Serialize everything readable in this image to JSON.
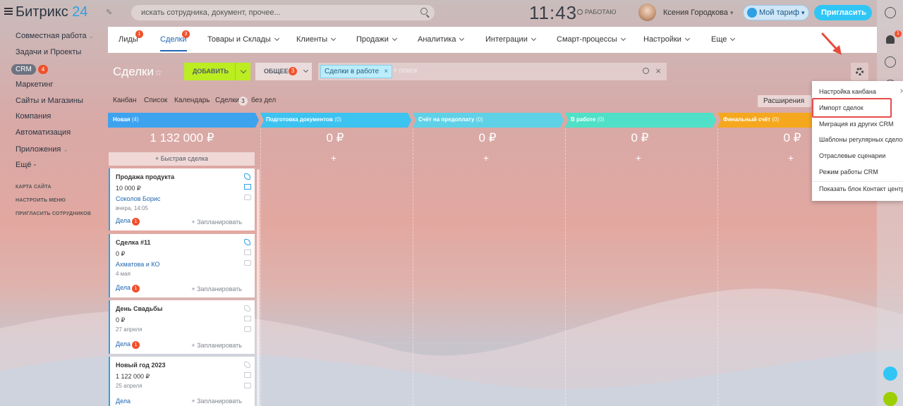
{
  "header": {
    "logo_text": "Битрикс",
    "logo_num": "24",
    "search_placeholder": "искать сотрудника, документ, прочее...",
    "clock": "11:43",
    "work_status": "РАБОТАЮ",
    "user_name": "Ксения Городкова",
    "tariff_label": "Мой тариф",
    "invite_label": "Пригласить"
  },
  "sidebar": {
    "items": [
      "Совместная работа",
      "Задачи и Проекты",
      "CRM",
      "Маркетинг",
      "Сайты и Магазины",
      "Компания",
      "Автоматизация",
      "Приложения",
      "Ещё -"
    ],
    "crm_badge": "4",
    "small_links": [
      "КАРТА САЙТА",
      "НАСТРОИТЬ МЕНЮ",
      "ПРИГЛАСИТЬ СОТРУДНИКОВ"
    ]
  },
  "tabs": {
    "items": [
      "Лиды",
      "Сделки",
      "Товары и Склады",
      "Клиенты",
      "Продажи",
      "Аналитика",
      "Интеграции",
      "Смарт-процессы",
      "Настройки",
      "Еще"
    ],
    "leads_badge": "1",
    "deals_badge": "3"
  },
  "toolbar": {
    "title": "Сделки",
    "add_label": "ДОБАВИТЬ",
    "filter_label": "ОБЩЕЕ",
    "filter_badge": "3",
    "chip_label": "Сделки в работе",
    "search_placeholder": "+ поиск"
  },
  "views": {
    "kanban": "Канбан",
    "list": "Список",
    "calendar": "Календарь",
    "deals_label": "Сделки:",
    "deals_count": "3",
    "no_tasks": "без дел",
    "extensions": "Расширения"
  },
  "columns": [
    {
      "name": "Новая",
      "count": "(4)",
      "sum": "1 132 000 ₽",
      "color": "#3ea3ef"
    },
    {
      "name": "Подготовка документов",
      "count": "(0)",
      "sum": "0 ₽",
      "color": "#3cc3f0"
    },
    {
      "name": "Счёт на предоплату",
      "count": "(0)",
      "sum": "0 ₽",
      "color": "#5fd1e6"
    },
    {
      "name": "В работе",
      "count": "(0)",
      "sum": "0 ₽",
      "color": "#4fe0c7"
    },
    {
      "name": "Финальный счёт",
      "count": "(0)",
      "sum": "0 ₽",
      "color": "#f5a81d"
    }
  ],
  "quick_deal": "Быстрая сделка",
  "cards": [
    {
      "title": "Продажа продукта",
      "sum": "10 000 ₽",
      "client": "Соколов Борис",
      "date": "вчера, 14:05",
      "tasks": "Дела",
      "tasks_badge": "1",
      "plan": "+ Запланировать"
    },
    {
      "title": "Сделка #11",
      "sum": "0 ₽",
      "client": "Ахматова и КО",
      "date": "4 мая",
      "tasks": "Дела",
      "tasks_badge": "1",
      "plan": "+ Запланировать"
    },
    {
      "title": "День Свадьбы",
      "sum": "0 ₽",
      "client": "",
      "date": "27 апреля",
      "tasks": "Дела",
      "tasks_badge": "1",
      "plan": "+ Запланировать"
    },
    {
      "title": "Новый год 2023",
      "sum": "1 122 000 ₽",
      "client": "",
      "date": "25 апреля",
      "tasks": "Дела",
      "tasks_badge": "",
      "plan": "+ Запланировать"
    }
  ],
  "menu": {
    "items": [
      "Настройка канбана",
      "Импорт сделок",
      "Миграция из других CRM",
      "Шаблоны регулярных сделок",
      "Отраслевые сценарии",
      "Режим работы CRM",
      "Показать блок Контакт центра"
    ]
  },
  "rail": {
    "notif_badge": "1"
  }
}
